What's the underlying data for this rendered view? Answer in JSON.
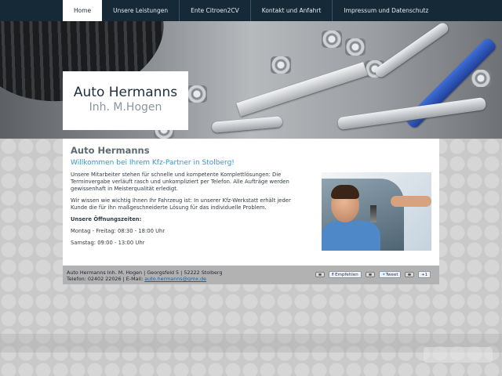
{
  "nav": {
    "items": [
      {
        "label": "Home",
        "active": true
      },
      {
        "label": "Unsere Leistungen",
        "active": false
      },
      {
        "label": "Ente Citroen2CV",
        "active": false
      },
      {
        "label": "Kontakt und Anfahrt",
        "active": false
      },
      {
        "label": "Impressum und Datenschutz",
        "active": false
      }
    ]
  },
  "logo": {
    "name": "Auto Hermanns",
    "sub": "Inh. M.Hogen"
  },
  "content": {
    "title": "Auto Hermanns",
    "subtitle": "Willkommen bei Ihrem Kfz-Partner in Stolberg!",
    "p1": "Unsere Mitarbeiter stehen für schnelle und kompetente Komplettlösungen: Die Terminvergabe verläuft rasch und unkompliziert per Telefon. Alle Aufträge werden gewissenhaft in Meisterqualität erledigt.",
    "p2": "Wir wissen wie wichtig Ihnen Ihr Fahrzeug ist: In unserer Kfz-Werkstatt erhält jeder Kunde die für ihn maßgeschneiderte Lösung für das individuelle Problem.",
    "hours_heading": "Unsere Öffnungszeiten:",
    "hours_weekdays": "Montag - Freitag: 08:30 - 18:00 Uhr",
    "hours_saturday": "Samstag: 09:00 - 13:00 Uhr"
  },
  "footer": {
    "line1": "Auto Hermanns Inh. M. Hogen | Georgsfeld 5 | 52222 Stolberg",
    "line2_prefix": "Telefon: 02402 22026 | E-Mail: ",
    "email": "auto.hermanns@gmx.de",
    "facebook_label": "Empfehlen",
    "twitter_label": "Tweet",
    "gplus_label": "+1"
  },
  "icons": {
    "facebook": "facebook-icon",
    "twitter": "twitter-icon",
    "privacy": "camera-privacy-icon"
  },
  "colors": {
    "nav_bg": "#152937",
    "subtitle": "#2f9bd1",
    "footer_bg": "#b2b2b2"
  }
}
